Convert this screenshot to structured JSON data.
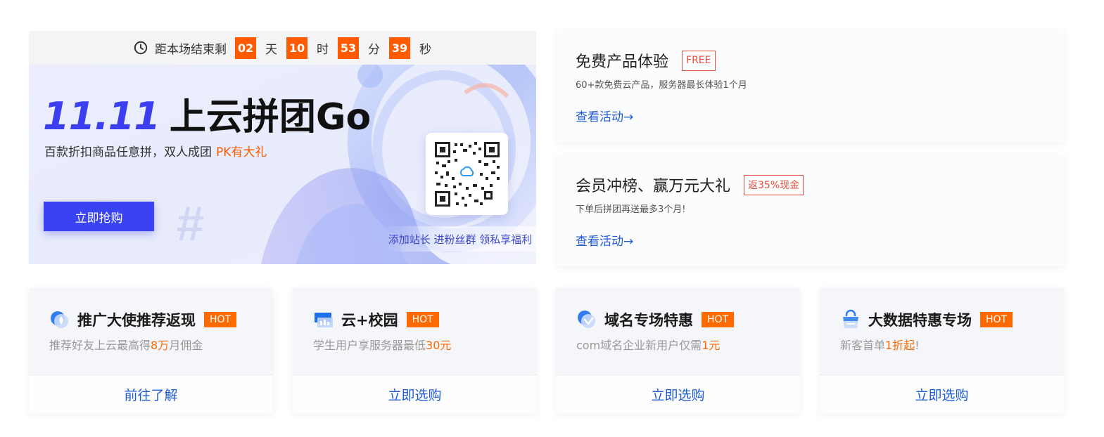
{
  "countdown": {
    "prefix": "距本场结束剩",
    "days": "02",
    "days_unit": "天",
    "hours": "10",
    "hours_unit": "时",
    "minutes": "53",
    "minutes_unit": "分",
    "seconds": "39",
    "seconds_unit": "秒"
  },
  "hero": {
    "title_number": "11.11",
    "title_text": "上云拼团Go",
    "subtitle": "百款折扣商品任意拼，双人成团",
    "subtitle_highlight": "PK有大礼",
    "button": "立即抢购",
    "qr_note": "添加站长 进粉丝群 领私享福利"
  },
  "promos": [
    {
      "title": "免费产品体验",
      "tag": "FREE",
      "desc": "60+款免费云产品，服务器最长体验1个月",
      "link": "查看活动→"
    },
    {
      "title": "会员冲榜、赢万元大礼",
      "tag": "返35%现金",
      "desc": "下单后拼团再送最多3个月!",
      "link": "查看活动→"
    }
  ],
  "cards": [
    {
      "name": "推广大使推荐返现",
      "hot": "HOT",
      "desc_pre": "推荐好友上云最高得",
      "desc_hl": "8万",
      "desc_post": "月佣金",
      "action": "前往了解"
    },
    {
      "name": "云+校园",
      "hot": "HOT",
      "desc_pre": "学生用户享服务器最低",
      "desc_hl": "30元",
      "desc_post": "",
      "action": "立即选购"
    },
    {
      "name": "域名专场特惠",
      "hot": "HOT",
      "desc_pre": "com域名企业新用户仅需",
      "desc_hl": "1元",
      "desc_post": "",
      "action": "立即选购"
    },
    {
      "name": "大数据特惠专场",
      "hot": "HOT",
      "desc_pre": "新客首单",
      "desc_hl": "1折起",
      "desc_post": "!",
      "action": "立即选购"
    }
  ],
  "colors": {
    "accent": "#ff5a00",
    "brand_blue": "#3a43f2",
    "link_blue": "#1f5bd4",
    "tag_red": "#e34d3d",
    "hot_orange": "#ff6a00"
  },
  "icons": [
    "clock-icon",
    "qr-code-icon",
    "user-referral-icon",
    "campus-icon",
    "domain-icon",
    "bigdata-bag-icon"
  ]
}
